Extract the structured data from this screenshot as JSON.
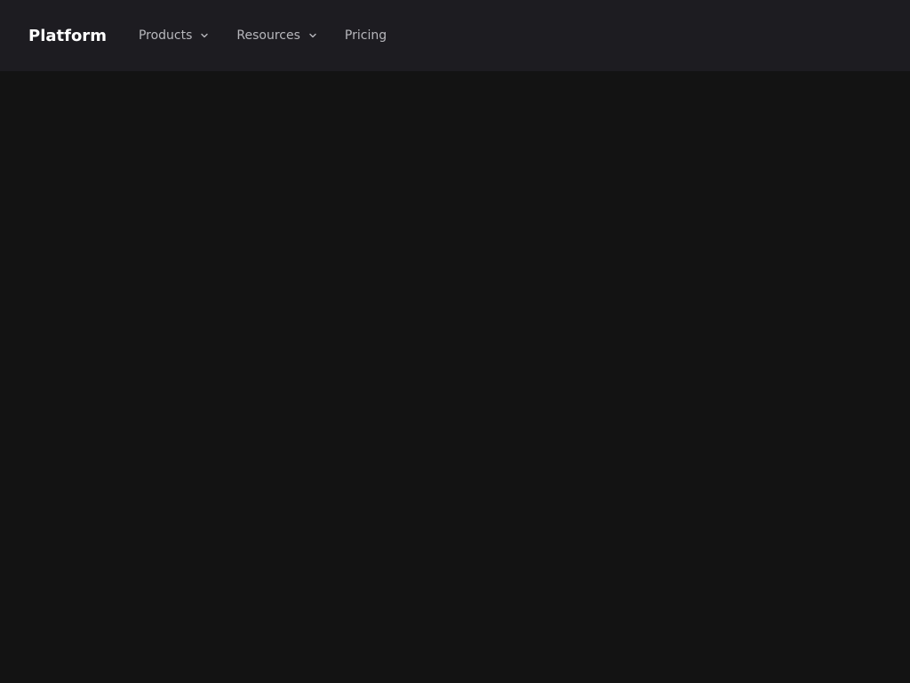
{
  "brand": {
    "label": "Platform"
  },
  "nav": {
    "items": [
      {
        "label": "Products",
        "icon": "chevron-down-icon",
        "has_dropdown": true
      },
      {
        "label": "Resources",
        "icon": "chevron-down-icon",
        "has_dropdown": true
      },
      {
        "label": "Pricing",
        "has_dropdown": false
      }
    ]
  },
  "colors": {
    "topbar_bg": "#1d1c21",
    "page_bg": "#131313",
    "brand_text": "#ffffff",
    "nav_text": "#b7b7bc"
  }
}
